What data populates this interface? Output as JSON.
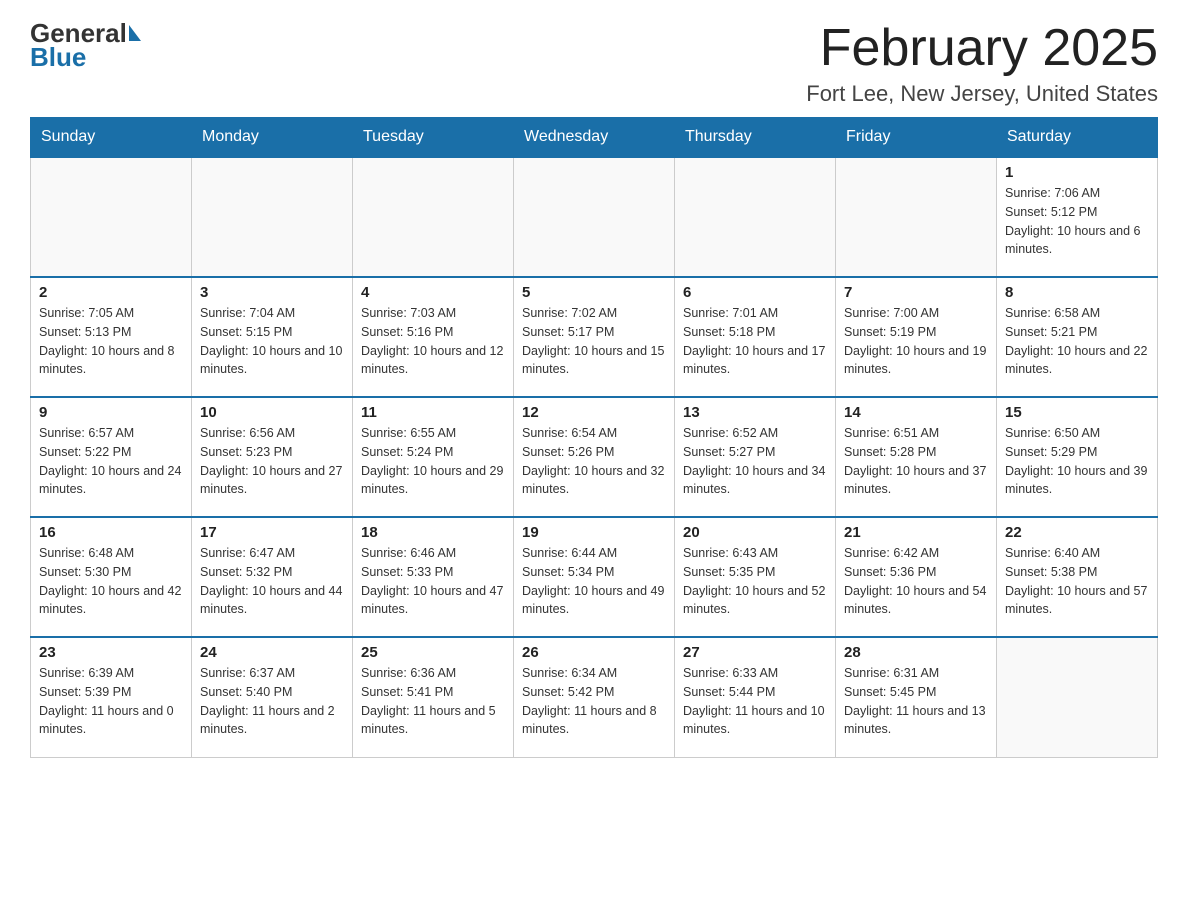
{
  "header": {
    "logo_general": "General",
    "logo_blue": "Blue",
    "month_title": "February 2025",
    "location": "Fort Lee, New Jersey, United States"
  },
  "days_of_week": [
    "Sunday",
    "Monday",
    "Tuesday",
    "Wednesday",
    "Thursday",
    "Friday",
    "Saturday"
  ],
  "weeks": [
    [
      {
        "day": "",
        "info": ""
      },
      {
        "day": "",
        "info": ""
      },
      {
        "day": "",
        "info": ""
      },
      {
        "day": "",
        "info": ""
      },
      {
        "day": "",
        "info": ""
      },
      {
        "day": "",
        "info": ""
      },
      {
        "day": "1",
        "info": "Sunrise: 7:06 AM\nSunset: 5:12 PM\nDaylight: 10 hours and 6 minutes."
      }
    ],
    [
      {
        "day": "2",
        "info": "Sunrise: 7:05 AM\nSunset: 5:13 PM\nDaylight: 10 hours and 8 minutes."
      },
      {
        "day": "3",
        "info": "Sunrise: 7:04 AM\nSunset: 5:15 PM\nDaylight: 10 hours and 10 minutes."
      },
      {
        "day": "4",
        "info": "Sunrise: 7:03 AM\nSunset: 5:16 PM\nDaylight: 10 hours and 12 minutes."
      },
      {
        "day": "5",
        "info": "Sunrise: 7:02 AM\nSunset: 5:17 PM\nDaylight: 10 hours and 15 minutes."
      },
      {
        "day": "6",
        "info": "Sunrise: 7:01 AM\nSunset: 5:18 PM\nDaylight: 10 hours and 17 minutes."
      },
      {
        "day": "7",
        "info": "Sunrise: 7:00 AM\nSunset: 5:19 PM\nDaylight: 10 hours and 19 minutes."
      },
      {
        "day": "8",
        "info": "Sunrise: 6:58 AM\nSunset: 5:21 PM\nDaylight: 10 hours and 22 minutes."
      }
    ],
    [
      {
        "day": "9",
        "info": "Sunrise: 6:57 AM\nSunset: 5:22 PM\nDaylight: 10 hours and 24 minutes."
      },
      {
        "day": "10",
        "info": "Sunrise: 6:56 AM\nSunset: 5:23 PM\nDaylight: 10 hours and 27 minutes."
      },
      {
        "day": "11",
        "info": "Sunrise: 6:55 AM\nSunset: 5:24 PM\nDaylight: 10 hours and 29 minutes."
      },
      {
        "day": "12",
        "info": "Sunrise: 6:54 AM\nSunset: 5:26 PM\nDaylight: 10 hours and 32 minutes."
      },
      {
        "day": "13",
        "info": "Sunrise: 6:52 AM\nSunset: 5:27 PM\nDaylight: 10 hours and 34 minutes."
      },
      {
        "day": "14",
        "info": "Sunrise: 6:51 AM\nSunset: 5:28 PM\nDaylight: 10 hours and 37 minutes."
      },
      {
        "day": "15",
        "info": "Sunrise: 6:50 AM\nSunset: 5:29 PM\nDaylight: 10 hours and 39 minutes."
      }
    ],
    [
      {
        "day": "16",
        "info": "Sunrise: 6:48 AM\nSunset: 5:30 PM\nDaylight: 10 hours and 42 minutes."
      },
      {
        "day": "17",
        "info": "Sunrise: 6:47 AM\nSunset: 5:32 PM\nDaylight: 10 hours and 44 minutes."
      },
      {
        "day": "18",
        "info": "Sunrise: 6:46 AM\nSunset: 5:33 PM\nDaylight: 10 hours and 47 minutes."
      },
      {
        "day": "19",
        "info": "Sunrise: 6:44 AM\nSunset: 5:34 PM\nDaylight: 10 hours and 49 minutes."
      },
      {
        "day": "20",
        "info": "Sunrise: 6:43 AM\nSunset: 5:35 PM\nDaylight: 10 hours and 52 minutes."
      },
      {
        "day": "21",
        "info": "Sunrise: 6:42 AM\nSunset: 5:36 PM\nDaylight: 10 hours and 54 minutes."
      },
      {
        "day": "22",
        "info": "Sunrise: 6:40 AM\nSunset: 5:38 PM\nDaylight: 10 hours and 57 minutes."
      }
    ],
    [
      {
        "day": "23",
        "info": "Sunrise: 6:39 AM\nSunset: 5:39 PM\nDaylight: 11 hours and 0 minutes."
      },
      {
        "day": "24",
        "info": "Sunrise: 6:37 AM\nSunset: 5:40 PM\nDaylight: 11 hours and 2 minutes."
      },
      {
        "day": "25",
        "info": "Sunrise: 6:36 AM\nSunset: 5:41 PM\nDaylight: 11 hours and 5 minutes."
      },
      {
        "day": "26",
        "info": "Sunrise: 6:34 AM\nSunset: 5:42 PM\nDaylight: 11 hours and 8 minutes."
      },
      {
        "day": "27",
        "info": "Sunrise: 6:33 AM\nSunset: 5:44 PM\nDaylight: 11 hours and 10 minutes."
      },
      {
        "day": "28",
        "info": "Sunrise: 6:31 AM\nSunset: 5:45 PM\nDaylight: 11 hours and 13 minutes."
      },
      {
        "day": "",
        "info": ""
      }
    ]
  ]
}
